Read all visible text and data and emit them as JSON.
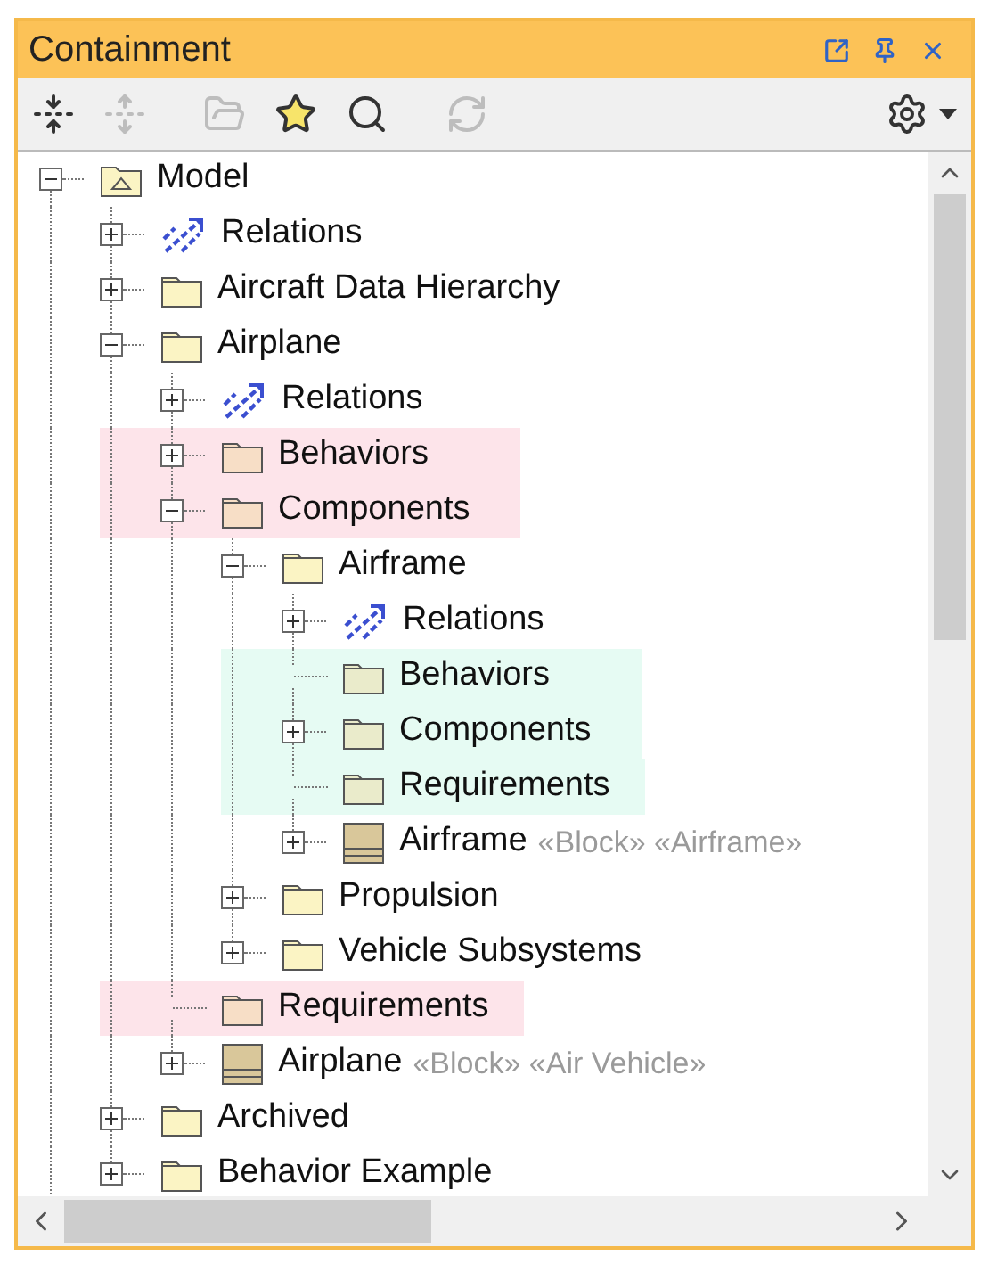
{
  "window": {
    "title": "Containment"
  },
  "title_buttons": [
    {
      "kind": "float"
    },
    {
      "kind": "pin"
    },
    {
      "kind": "close"
    }
  ],
  "toolbar": [
    {
      "kind": "collapse",
      "disabled": false
    },
    {
      "kind": "expand",
      "disabled": true
    },
    {
      "kind": "open",
      "disabled": true
    },
    {
      "kind": "star",
      "disabled": false
    },
    {
      "kind": "search",
      "disabled": false
    },
    {
      "kind": "sync",
      "disabled": true
    },
    {
      "kind": "settings",
      "disabled": false
    }
  ],
  "tree": [
    {
      "label": "Model",
      "kind": "model",
      "has_children": true,
      "expanded": true,
      "highlighted": false,
      "children": [
        {
          "label": "Relations",
          "kind": "relations",
          "has_children": true,
          "expanded": false,
          "highlighted": false
        },
        {
          "label": "Aircraft Data Hierarchy",
          "kind": "folder",
          "has_children": true,
          "expanded": false,
          "highlighted": false
        },
        {
          "label": "Airplane",
          "kind": "folder",
          "has_children": true,
          "expanded": true,
          "highlighted": false,
          "children": [
            {
              "label": "Relations",
              "kind": "relations",
              "has_children": true,
              "expanded": false,
              "highlighted": false
            },
            {
              "label": "Behaviors",
              "kind": "folder",
              "has_children": true,
              "expanded": false,
              "highlighted": true,
              "color": "#fde4ea"
            },
            {
              "label": "Components",
              "kind": "folder",
              "has_children": true,
              "expanded": true,
              "highlighted": true,
              "color": "#fde4ea",
              "children": [
                {
                  "label": "Airframe",
                  "kind": "folder",
                  "has_children": true,
                  "expanded": true,
                  "highlighted": false,
                  "children": [
                    {
                      "label": "Relations",
                      "kind": "relations",
                      "has_children": true,
                      "expanded": false,
                      "highlighted": false
                    },
                    {
                      "label": "Behaviors",
                      "kind": "folder",
                      "has_children": false,
                      "highlighted": true,
                      "color": "#e6fbf3"
                    },
                    {
                      "label": "Components",
                      "kind": "folder",
                      "has_children": true,
                      "expanded": false,
                      "highlighted": true,
                      "color": "#e6fbf3"
                    },
                    {
                      "label": "Requirements",
                      "kind": "folder",
                      "has_children": false,
                      "highlighted": true,
                      "color": "#e6fbf3"
                    },
                    {
                      "label": "Airframe",
                      "kind": "block",
                      "has_children": true,
                      "expanded": false,
                      "highlighted": false,
                      "stereotypes": "«Block» «Airframe»"
                    }
                  ]
                },
                {
                  "label": "Propulsion",
                  "kind": "folder",
                  "has_children": true,
                  "expanded": false,
                  "highlighted": false
                },
                {
                  "label": "Vehicle Subsystems",
                  "kind": "folder",
                  "has_children": true,
                  "expanded": false,
                  "highlighted": false
                }
              ]
            },
            {
              "label": "Requirements",
              "kind": "folder",
              "has_children": false,
              "highlighted": true,
              "color": "#fde4ea"
            },
            {
              "label": "Airplane",
              "kind": "block",
              "has_children": true,
              "expanded": false,
              "highlighted": false,
              "stereotypes": "«Block» «Air Vehicle»"
            }
          ]
        },
        {
          "label": "Archived",
          "kind": "folder",
          "has_children": true,
          "expanded": false,
          "highlighted": false
        },
        {
          "label": "Behavior Example",
          "kind": "folder",
          "has_children": true,
          "expanded": false,
          "highlighted": false
        }
      ]
    }
  ]
}
